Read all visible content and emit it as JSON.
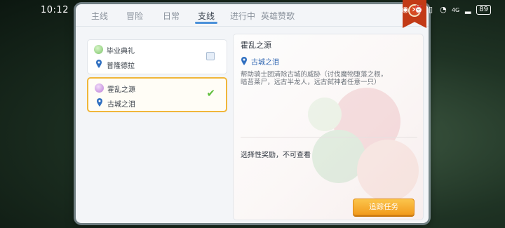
{
  "status_bar": {
    "time": "10:12",
    "signal_text": "4G",
    "battery": "89"
  },
  "tabs": [
    {
      "label": "主线",
      "active": false
    },
    {
      "label": "冒险",
      "active": false
    },
    {
      "label": "日常",
      "active": false
    },
    {
      "label": "支线",
      "active": true
    },
    {
      "label": "进行中",
      "active": false
    },
    {
      "label": "英雄赞歌",
      "active": false
    }
  ],
  "quests": [
    {
      "title": "毕业典礼",
      "location": "普隆德拉",
      "icon": "green-orb-icon",
      "state": "unchecked"
    },
    {
      "title": "霍乱之源",
      "location": "古城之泪",
      "icon": "purple-orb-icon",
      "state": "checked"
    }
  ],
  "detail": {
    "title": "霍乱之源",
    "location": "古城之泪",
    "description": "帮助骑士团清除古城的威胁（讨伐魔物堕落之根，暗苔莱尸，远古半龙人，远古弑神者任意一只）",
    "reward_text": "选择性奖励，不可查看",
    "track_button": "追踪任务"
  },
  "colors": {
    "accent": "#4a90d9",
    "selected_border": "#f0b63a",
    "button": "#f29b1d",
    "location_text": "#2b63b0",
    "ribbon": "#c23a16"
  }
}
